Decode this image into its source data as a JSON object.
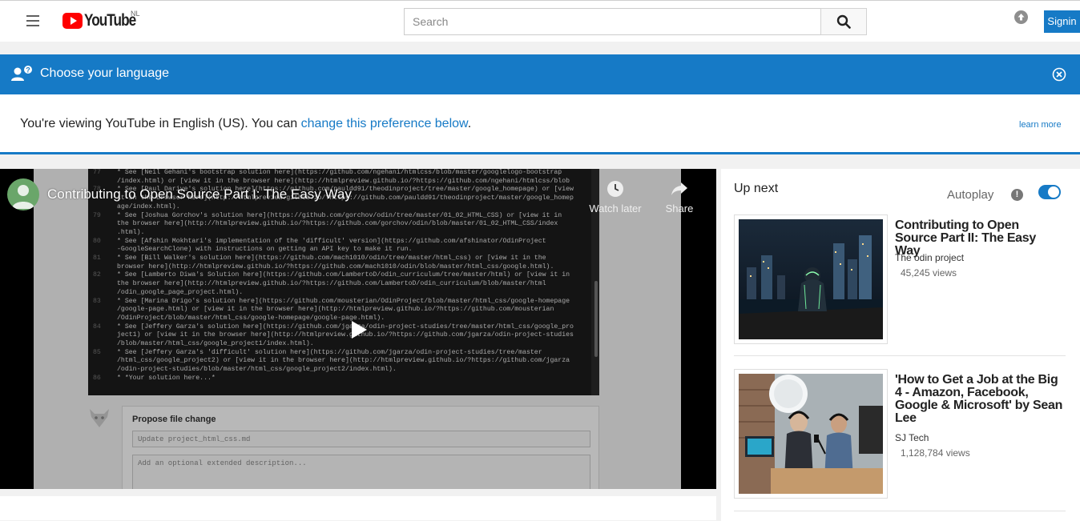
{
  "header": {
    "logo_text": "YouTube",
    "region": "NL",
    "search_placeholder": "Search",
    "signin_label": "Signin"
  },
  "language_banner": {
    "title": "Choose your language",
    "message_prefix": "You're viewing YouTube in English (US). You can ",
    "message_link": "change this preference below",
    "message_suffix": ".",
    "learn_more": "learn more"
  },
  "player": {
    "title": "Contributing to Open Source Part I: The Easy Way",
    "watch_later_label": "Watch later",
    "share_label": "Share",
    "code_lines": [
      {
        "ln": "77",
        "text": "* See [Neil Gehani's bootstrap solution here](https://github.com/ngehani/htmlcss/blob/master/googlelogo-bootstrap"
      },
      {
        "ln": "",
        "text": "/index.html) or [view it in the browser here](http://htmlpreview.github.io/?https://github.com/ngehani/htmlcss/blob"
      },
      {
        "ln": "78",
        "text": "* See [Paul Dariye's solution here](https://github.com/pauldd91/theodinproject/tree/master/google_homepage) or [view"
      },
      {
        "ln": "",
        "text": "it in the browser here](http://htmlpreview.github.io/?https://github.com/pauldd91/theodinproject/master/google_homep"
      },
      {
        "ln": "",
        "text": "age/index.html)."
      },
      {
        "ln": "79",
        "text": "* See [Joshua Gorchov's solution here](https://github.com/gorchov/odin/tree/master/01_02_HTML_CSS) or [view it in"
      },
      {
        "ln": "",
        "text": "the browser here](http://htmlpreview.github.io/?https://github.com/gorchov/odin/blob/master/01_02_HTML_CSS/index"
      },
      {
        "ln": "",
        "text": ".html)."
      },
      {
        "ln": "80",
        "text": "* See [Afshin Mokhtari's implementation of the 'difficult' version](https://github.com/afshinator/OdinProject"
      },
      {
        "ln": "",
        "text": "-GoogleSearchClone) with instructions on getting an API key to make it run."
      },
      {
        "ln": "81",
        "text": "* See [Bill Walker's solution here](https://github.com/mach1010/odin/tree/master/html_css) or [view it in the"
      },
      {
        "ln": "",
        "text": "browser here](http://htmlpreview.github.io/?https://github.com/mach1010/odin/blob/master/html_css/google.html)."
      },
      {
        "ln": "82",
        "text": "* See [Lamberto Diwa's Solution here](https://github.com/LambertoD/odin_curriculum/tree/master/html) or [view it in"
      },
      {
        "ln": "",
        "text": "the browser here](http://htmlpreview.github.io/?https://github.com/LambertoD/odin_curriculum/blob/master/html"
      },
      {
        "ln": "",
        "text": "/odin_google_page_project.html)."
      },
      {
        "ln": "83",
        "text": "* See [Marina Drigo's solution here](https://github.com/mousterian/OdinProject/blob/master/html_css/google-homepage"
      },
      {
        "ln": "",
        "text": "/google-page.html) or [view it in the browser here](http://htmlpreview.github.io/?https://github.com/mousterian"
      },
      {
        "ln": "",
        "text": "/OdinProject/blob/master/html_css/google-homepage/google-page.html)."
      },
      {
        "ln": "84",
        "text": "* See [Jeffery Garza's solution here](https://github.com/jgarza/odin-project-studies/tree/master/html_css/google_pro"
      },
      {
        "ln": "",
        "text": "ject1) or [view it in the browser here](http://htmlpreview.github.io/?https://github.com/jgarza/odin-project-studies"
      },
      {
        "ln": "",
        "text": "/blob/master/html_css/google_project1/index.html)."
      },
      {
        "ln": "85",
        "text": "* See [Jeffery Garza's 'difficult' solution here](https://github.com/jgarza/odin-project-studies/tree/master"
      },
      {
        "ln": "",
        "text": "/html_css/google_project2) or [view it in the browser here](http://htmlpreview.github.io/?https://github.com/jgarza"
      },
      {
        "ln": "",
        "text": "/odin-project-studies/blob/master/html_css/google_project2/index.html)."
      },
      {
        "ln": "86",
        "text": "* *Your solution here...*"
      }
    ],
    "propose_title": "Propose file change",
    "propose_input": "Update project_html_css.md",
    "propose_area": "Add an optional extended description..."
  },
  "sidebar": {
    "up_next": "Up next",
    "autoplay": "Autoplay",
    "autoplay_on": true,
    "recommendations": [
      {
        "title": "Contributing to Open Source Part II: The Easy Way",
        "channel": "The odin project",
        "views": "45,245 views",
        "thumb": "city-night"
      },
      {
        "title": "'How to Get a Job at the Big 4 - Amazon, Facebook, Google & Microsoft' by Sean Lee",
        "channel": "SJ Tech",
        "views": "1,128,784 views",
        "thumb": "podcast-studio"
      }
    ]
  },
  "colors": {
    "brand_red": "#ff0000",
    "accent_blue": "#167ac6"
  }
}
